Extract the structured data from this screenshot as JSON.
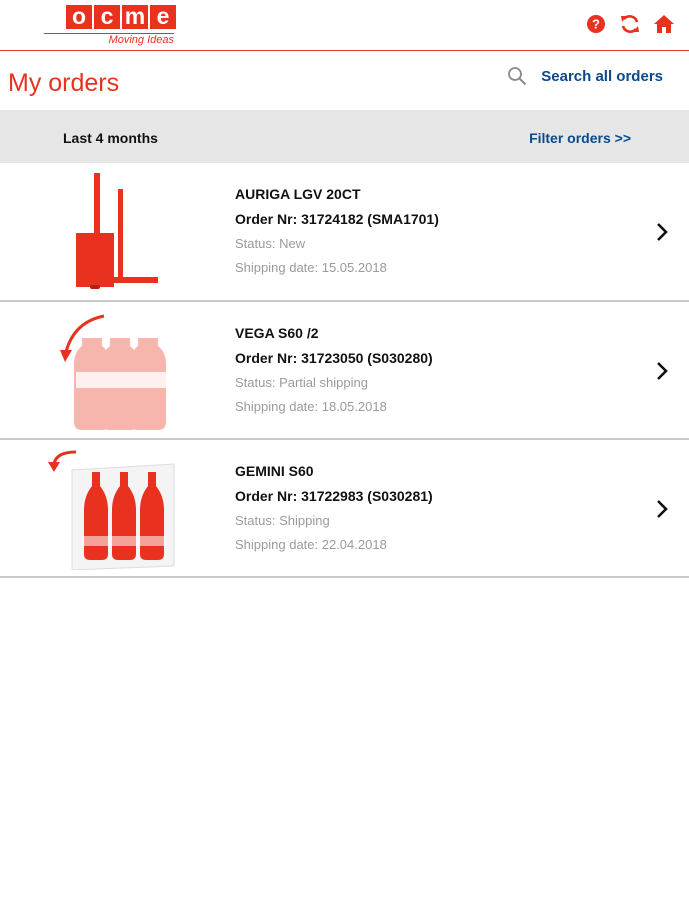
{
  "header": {
    "logo_letters": [
      "o",
      "c",
      "m",
      "e"
    ],
    "logo_tagline": "Moving Ideas",
    "icons": [
      "help-icon",
      "refresh-icon",
      "home-icon"
    ],
    "accent_color": "#e8321f",
    "link_color": "#0a4a8a"
  },
  "title_row": {
    "title": "My orders",
    "search_label": "Search all orders"
  },
  "filter_bar": {
    "period": "Last 4 months",
    "filter_label": "Filter orders >>"
  },
  "orders": [
    {
      "product": "AURIGA LGV 20CT",
      "order_nr": "Order Nr: 31724182 (SMA1701)",
      "status": "Status: New",
      "shipping_date": "Shipping date: 15.05.2018",
      "image": "forklift-icon"
    },
    {
      "product": "VEGA S60 /2",
      "order_nr": "Order Nr: 31723050 (S030280)",
      "status": "Status: Partial shipping",
      "shipping_date": "Shipping date: 18.05.2018",
      "image": "bottle-pack-icon"
    },
    {
      "product": "GEMINI S60",
      "order_nr": "Order Nr: 31722983 (S030281)",
      "status": "Status: Shipping",
      "shipping_date": "Shipping date: 22.04.2018",
      "image": "bottle-tray-icon"
    }
  ]
}
